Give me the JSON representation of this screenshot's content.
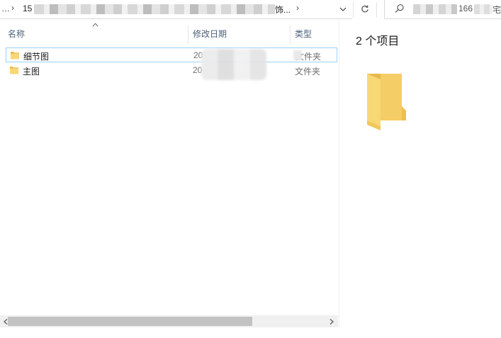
{
  "address_bar": {
    "overflow_glyph": "…",
    "separator": "›",
    "path_start": "15",
    "path_end": "饰...",
    "dropdown_icon": "chevron-down-icon",
    "refresh_icon": "refresh-icon"
  },
  "search": {
    "icon": "search-icon",
    "visible_fragment": "166",
    "visible_tail": "宅"
  },
  "columns": {
    "name": "名称",
    "date_modified": "修改日期",
    "type": "类型"
  },
  "files": [
    {
      "name": "细节图",
      "date": "20",
      "type": "文件夹",
      "selected": true
    },
    {
      "name": "主图",
      "date": "20",
      "type": "文件夹",
      "selected": false
    }
  ],
  "preview": {
    "item_count": "2 个项目"
  },
  "colors": {
    "folder": "#f8d775",
    "folder_dark": "#e8b84a",
    "selection_border": "#99d1ff",
    "header_text": "#4c607a"
  }
}
